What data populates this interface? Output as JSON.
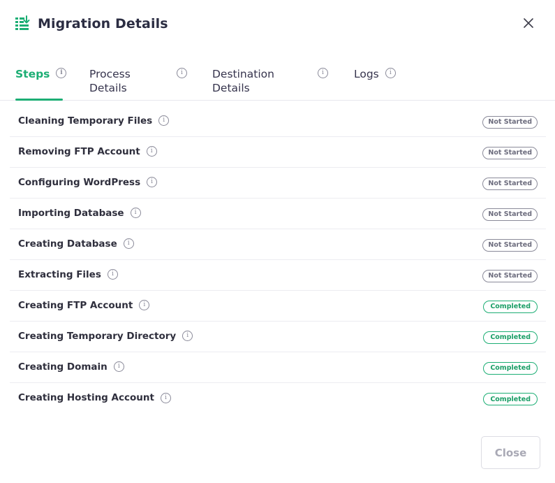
{
  "dialog": {
    "title": "Migration Details",
    "icon": "migration-icon",
    "close_icon": "close-icon",
    "accent_color": "#1cae74"
  },
  "tabs": [
    {
      "label": "Steps",
      "active": true
    },
    {
      "label": "Process Details",
      "active": false
    },
    {
      "label": "Destination Details",
      "active": false
    },
    {
      "label": "Logs",
      "active": false
    }
  ],
  "steps": [
    {
      "name": "Cleaning Temporary Files",
      "status": "Not Started"
    },
    {
      "name": "Removing FTP Account",
      "status": "Not Started"
    },
    {
      "name": "Configuring WordPress",
      "status": "Not Started"
    },
    {
      "name": "Importing Database",
      "status": "Not Started"
    },
    {
      "name": "Creating Database",
      "status": "Not Started"
    },
    {
      "name": "Extracting Files",
      "status": "Not Started"
    },
    {
      "name": "Creating FTP Account",
      "status": "Completed"
    },
    {
      "name": "Creating Temporary Directory",
      "status": "Completed"
    },
    {
      "name": "Creating Domain",
      "status": "Completed"
    },
    {
      "name": "Creating Hosting Account",
      "status": "Completed"
    }
  ],
  "footer": {
    "close_label": "Close"
  }
}
